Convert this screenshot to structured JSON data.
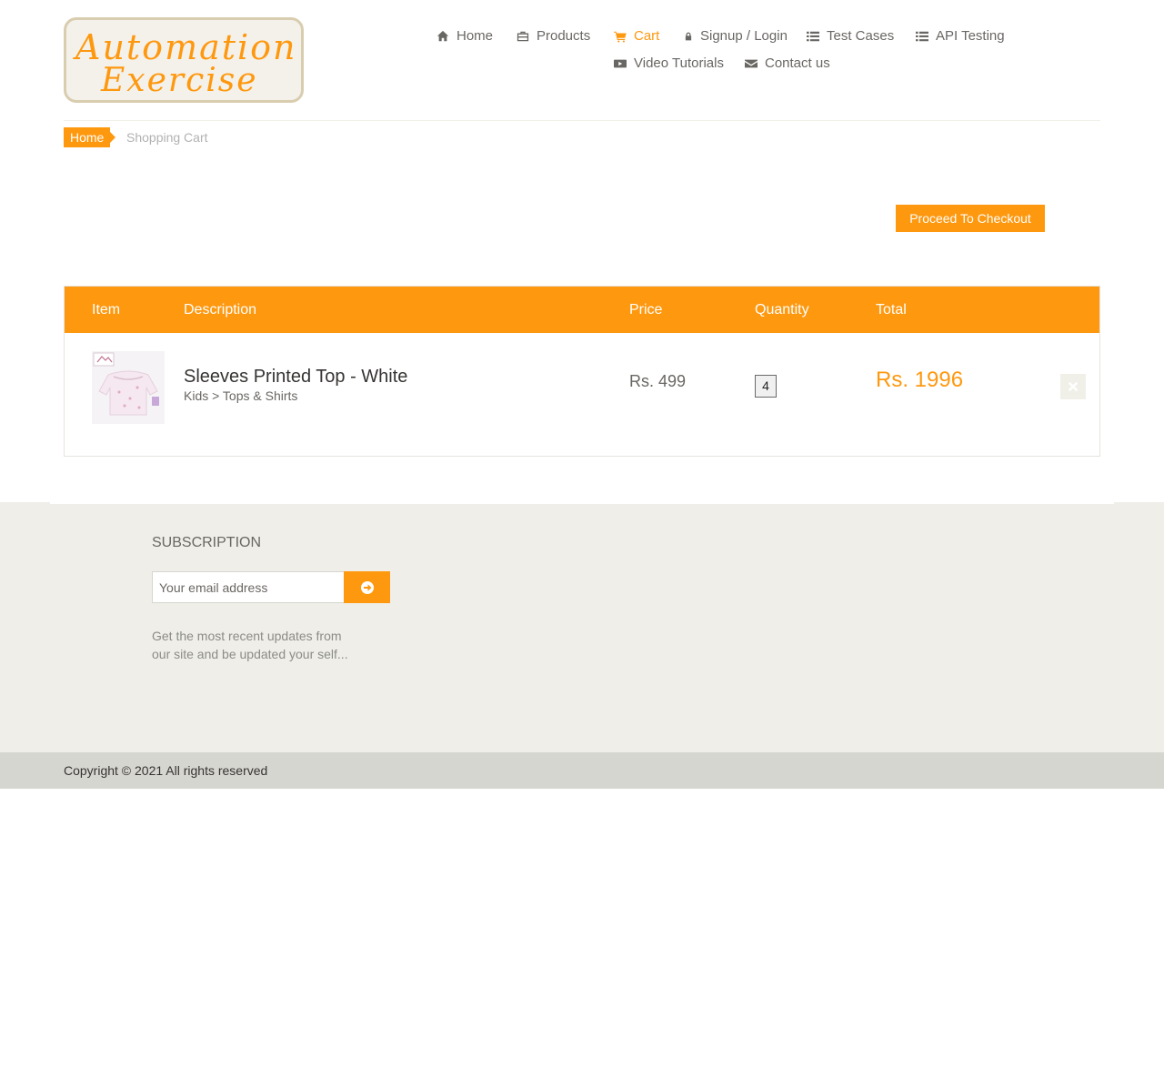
{
  "header": {
    "logo": {
      "line1": "Automation",
      "line2": "Exercise"
    },
    "nav": {
      "home": "Home",
      "products": "Products",
      "cart": "Cart",
      "signup_login": "Signup / Login",
      "test_cases": "Test Cases",
      "api_testing": "API Testing",
      "video_tutorials": "Video Tutorials",
      "contact_us": "Contact us"
    },
    "active_item": "cart"
  },
  "breadcrumb": {
    "home": "Home",
    "current": "Shopping Cart"
  },
  "checkout_button": "Proceed To Checkout",
  "cart": {
    "columns": {
      "item": "Item",
      "description": "Description",
      "price": "Price",
      "quantity": "Quantity",
      "total": "Total"
    },
    "rows": [
      {
        "name": "Sleeves Printed Top - White",
        "category": "Kids > Tops & Shirts",
        "price": "Rs. 499",
        "quantity": "4",
        "total": "Rs. 1996"
      }
    ]
  },
  "footer": {
    "subscription": {
      "title": "SUBSCRIPTION",
      "placeholder": "Your email address",
      "text": "Get the most recent updates from our site and be updated your self..."
    },
    "copyright": "Copyright © 2021 All rights reserved"
  },
  "colors": {
    "accent": "#fe980f",
    "text": "#696763",
    "footer_bg": "#efeee8",
    "footer_bottom_bg": "#d6d6d0"
  },
  "icons": [
    "home-icon",
    "briefcase-icon",
    "cart-icon",
    "lock-icon",
    "list-icon",
    "youtube-play-icon",
    "envelope-icon",
    "close-icon",
    "arrow-circle-right-icon"
  ]
}
